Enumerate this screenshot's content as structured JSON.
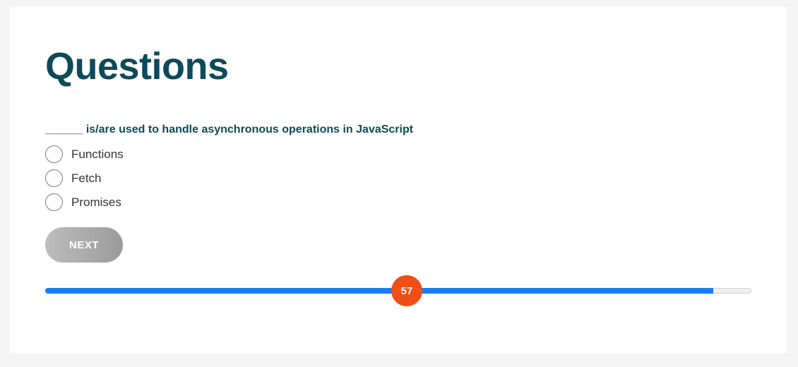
{
  "page": {
    "title": "Questions"
  },
  "question": {
    "text": "______ is/are used to handle asynchronous operations in JavaScript",
    "options": [
      {
        "label": "Functions",
        "selected": false
      },
      {
        "label": "Fetch",
        "selected": false
      },
      {
        "label": "Promises",
        "selected": false
      }
    ]
  },
  "actions": {
    "next_label": "NEXT"
  },
  "progress": {
    "value": 57,
    "value_label": "57",
    "fill_fraction": 0.946
  },
  "colors": {
    "title": "#0d4a5a",
    "progress_fill": "#1a7cf4",
    "thumb": "#f04e16"
  }
}
